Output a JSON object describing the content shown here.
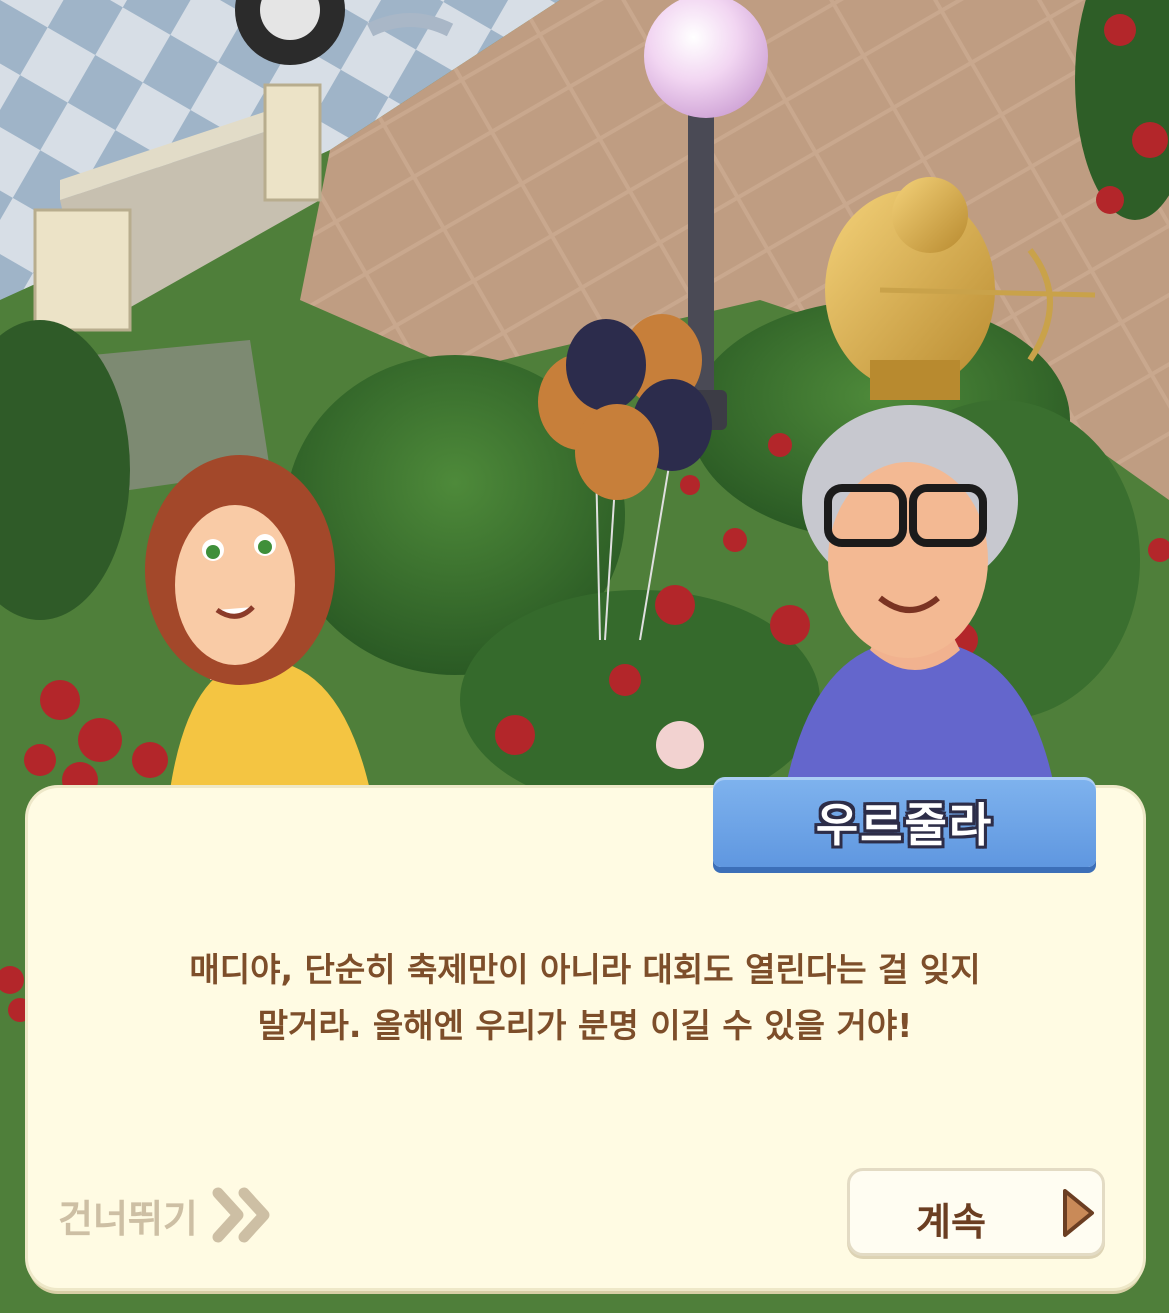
{
  "dialog": {
    "speaker": "우르줄라",
    "lines": [
      "매디야, 단순히 축제만이 아니라 대회도 열린다는 걸 잊지",
      "말거라. 올해엔 우리가 분명 이길 수 있을 거야!"
    ]
  },
  "controls": {
    "skip_label": "건너뛰기",
    "continue_label": "계속"
  },
  "colors": {
    "dialog_bg": "#fffbe3",
    "speaker_tag": "#6fa5e8",
    "text": "#7d4e2a",
    "continue_arrow": "#c98a58"
  }
}
